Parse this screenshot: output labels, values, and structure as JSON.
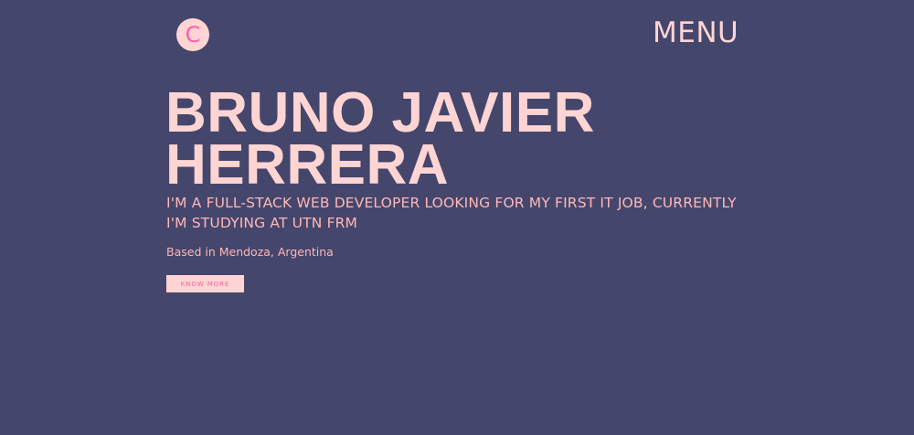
{
  "header": {
    "logo_letter": "C",
    "menu_label": "MENU"
  },
  "hero": {
    "name_line_1": "BRUNO JAVIER",
    "name_line_2": "HERRERA",
    "subtitle": "I'M A FULL-STACK WEB DEVELOPER LOOKING FOR MY FIRST IT JOB, CURRENTLY I'M STUDYING AT UTN FRM",
    "location": "Based in Mendoza, Argentina",
    "cta_label": "KNOW MORE"
  },
  "colors": {
    "background": "#45466c",
    "accent_light": "#ffd5d3",
    "accent_text": "#ffb8b6",
    "accent_pink": "#ff5fa5"
  }
}
